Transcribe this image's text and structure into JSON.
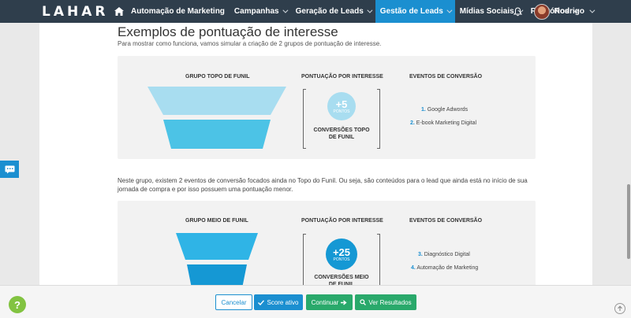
{
  "navbar": {
    "logo": "LAHAR",
    "items": [
      {
        "label": "Automação de Marketing",
        "has_caret": false
      },
      {
        "label": "Campanhas",
        "has_caret": true
      },
      {
        "label": "Geração de Leads",
        "has_caret": true
      },
      {
        "label": "Gestão de Leads",
        "has_caret": true,
        "active": true
      },
      {
        "label": "Mídias Sociais",
        "has_caret": true
      },
      {
        "label": "Relatórios",
        "has_caret": true
      }
    ],
    "user_name": "Rodrigo"
  },
  "page": {
    "title": "Exemplos de pontuação de interesse",
    "intro": "Para mostrar como funciona, vamos simular a criação de 2 grupos de pontuação de interesse.",
    "description": "Neste grupo, existem 2 eventos de conversão focados ainda no Topo do Funil. Ou seja, são conteúdos para o lead que ainda está no início de sua jornada de compra e por isso possuem uma pontuação menor."
  },
  "panels": [
    {
      "group_heading": "GRUPO TOPO DE FUNIL",
      "points_heading": "PONTUAÇÃO POR INTERESSE",
      "events_heading": "EVENTOS DE CONVERSÃO",
      "points": "+5",
      "points_unit": "PONTOS",
      "conversion_label": "CONVERSÕES TOPO DE FUNIL",
      "events": [
        {
          "number": "1.",
          "label": "Google Adwords"
        },
        {
          "number": "2.",
          "label": "E-book Marketing Digital"
        }
      ]
    },
    {
      "group_heading": "GRUPO MEIO DE FUNIL",
      "points_heading": "PONTUAÇÃO POR INTERESSE",
      "events_heading": "EVENTOS DE CONVERSÃO",
      "points": "+25",
      "points_unit": "PONTOS",
      "conversion_label": "CONVERSÕES MEIO DE FUNIL",
      "events": [
        {
          "number": "3.",
          "label": "Diagnóstico Digital"
        },
        {
          "number": "4.",
          "label": "Automação de Marketing"
        }
      ]
    }
  ],
  "actions": {
    "cancel": "Cancelar",
    "score_active": "Score ativo",
    "continue": "Continuar",
    "results": "Ver Resultados"
  },
  "help_label": "?",
  "colors": {
    "navbar": "#2f3e4c",
    "accent": "#1b8fd0",
    "green": "#29a96b",
    "funnel_top_light": "#a8ddf0",
    "funnel_top_dark": "#4cc3e6",
    "funnel_mid_light": "#2fb4e6",
    "funnel_mid_dark": "#1598d4"
  }
}
